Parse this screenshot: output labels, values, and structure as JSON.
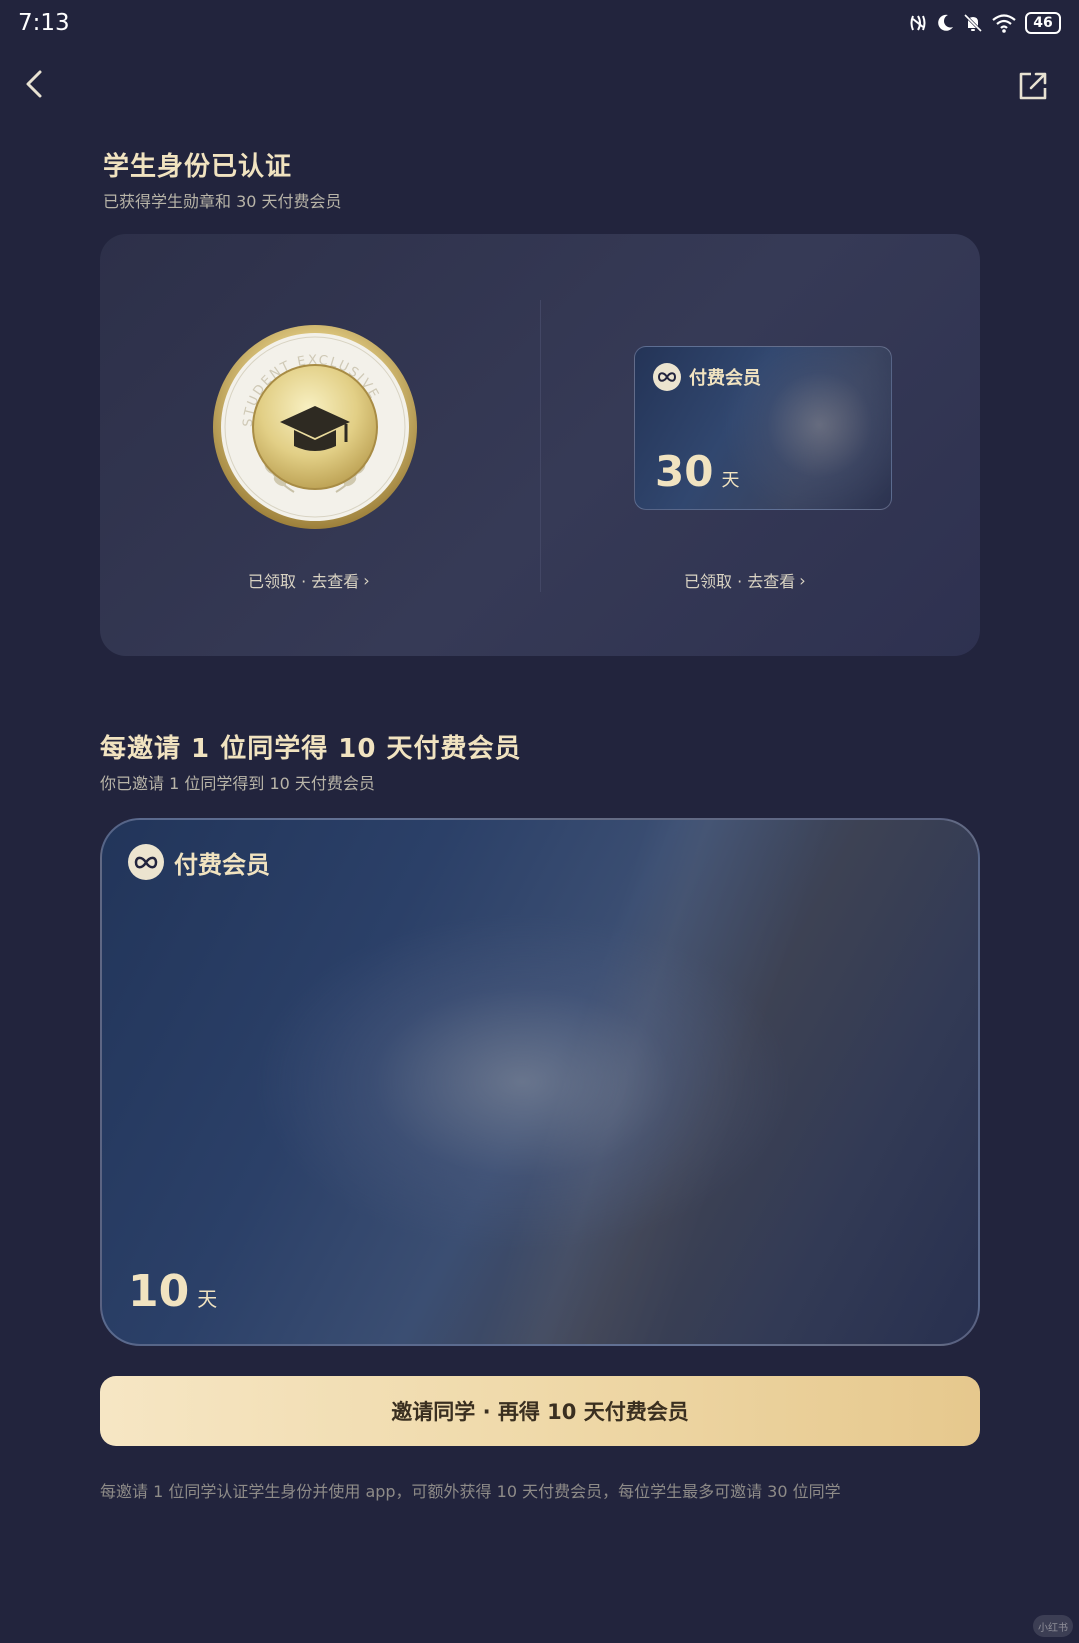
{
  "status_bar": {
    "time": "7:13",
    "battery": "46"
  },
  "header": {
    "back_icon": "chevron-left-icon",
    "share_icon": "share-external-icon"
  },
  "verified": {
    "title": "学生身份已认证",
    "subtitle": "已获得学生勋章和 30 天付费会员",
    "badge_ring_text": "STUDENT EXCLUSIVE",
    "badge_link": "已领取 · 去查看",
    "membership_card": {
      "brand": "付费会员",
      "days": "30",
      "unit": "天"
    },
    "membership_link": "已领取 · 去查看"
  },
  "invite": {
    "title": "每邀请 1 位同学得 10 天付费会员",
    "subtitle": "你已邀请 1 位同学得到 10 天付费会员",
    "card": {
      "brand": "付费会员",
      "days": "10",
      "unit": "天"
    },
    "cta_label": "邀请同学 · 再得 10 天付费会员",
    "footnote": "每邀请 1 位同学认证学生身份并使用 app，可额外获得 10 天付费会员，每位学生最多可邀请 30 位同学"
  },
  "colors": {
    "background": "#22243d",
    "gold_text": "#f1e3c0",
    "cta": "#efd9a9"
  }
}
